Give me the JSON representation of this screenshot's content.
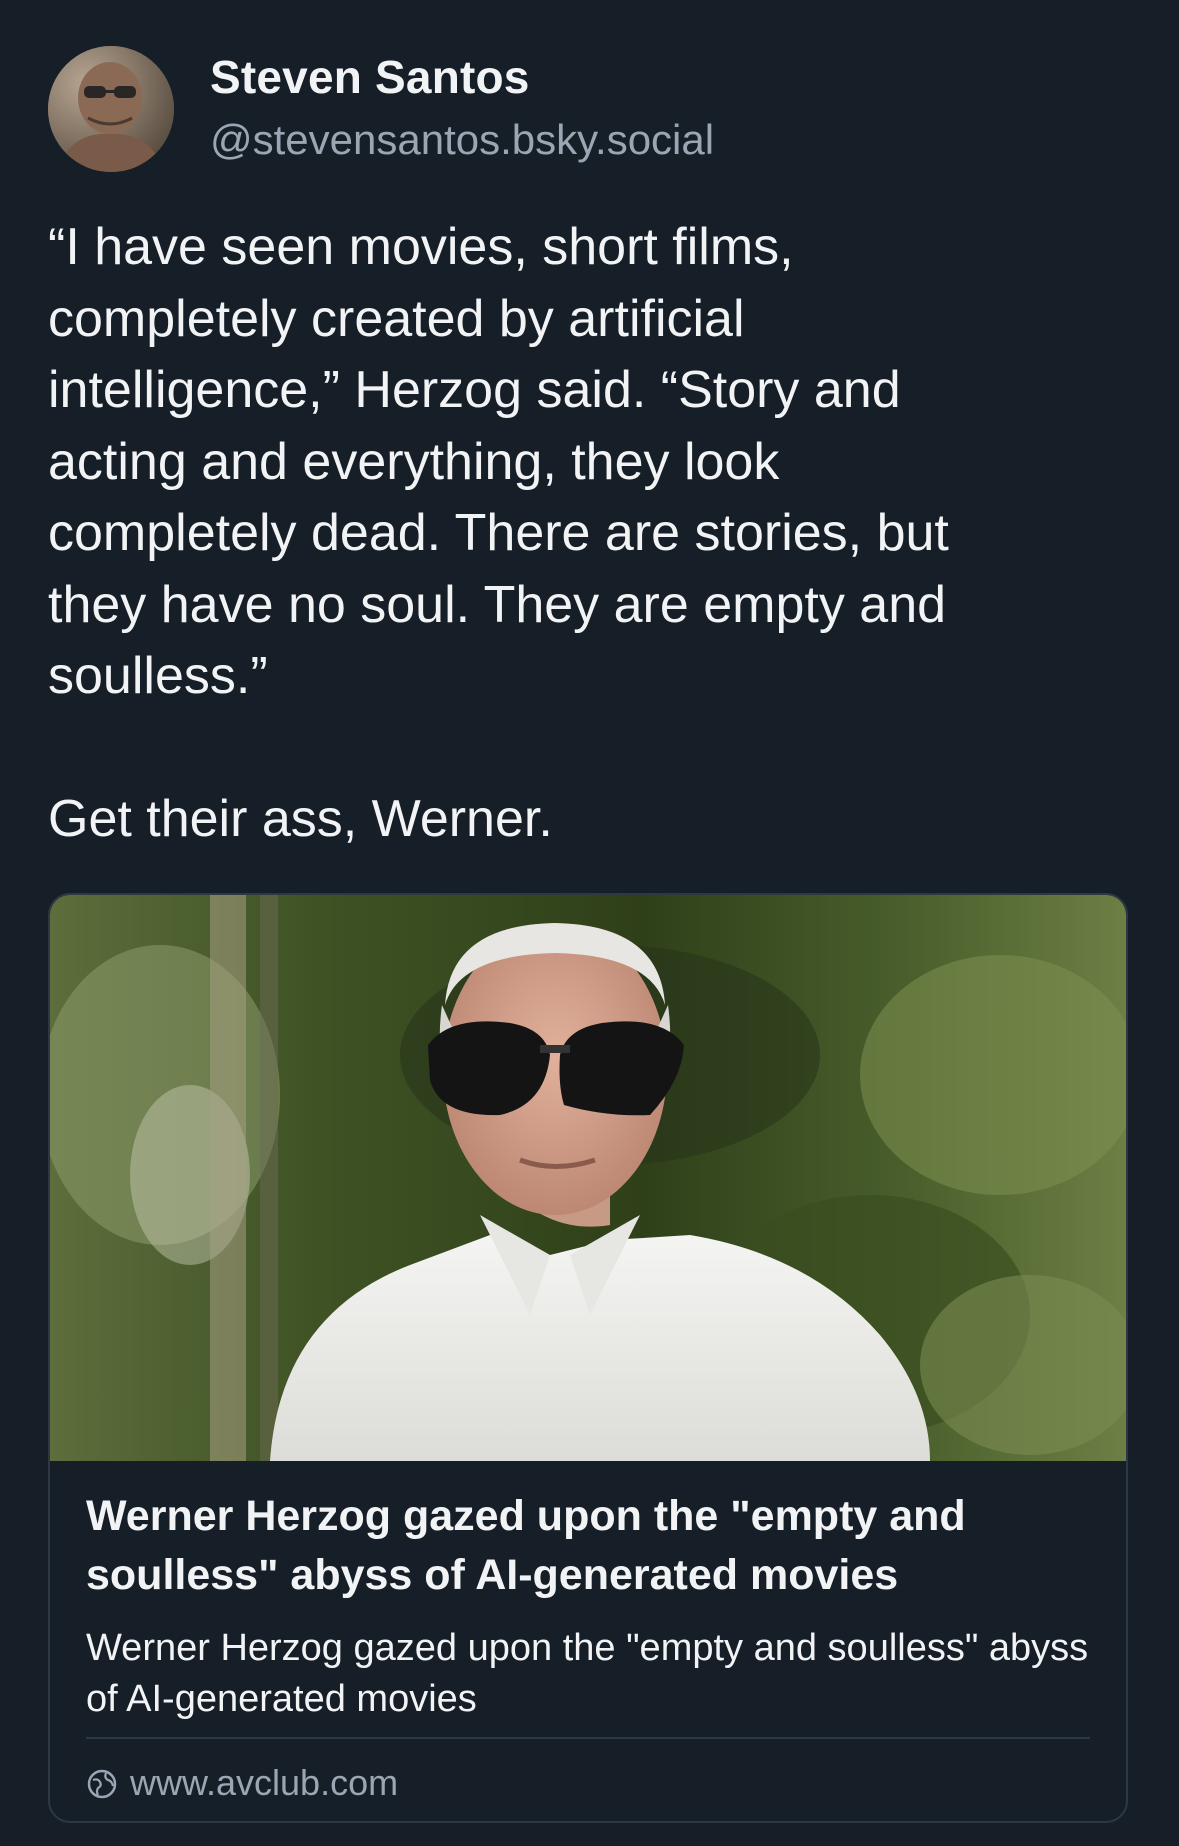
{
  "author": {
    "display_name": "Steven Santos",
    "handle": "@stevensantos.bsky.social",
    "avatar_icon": "avatar-photo"
  },
  "post": {
    "text": "“I have seen movies, short films,\ncompletely created by artificial\nintelligence,” Herzog said. “Story and\nacting and everything, they look\ncompletely dead. There are stories, but\nthey have no soul. They are empty and\nsoulless.”\n\nGet their ass, Werner."
  },
  "link_card": {
    "image_icon": "article-thumbnail-photo",
    "title": "Werner Herzog gazed upon the \"empty and soulless\" abyss of AI-generated movies",
    "description": "Werner Herzog gazed upon the \"empty and soulless\" abyss of AI-generated movies",
    "domain": "www.avclub.com",
    "domain_icon": "globe-icon"
  },
  "colors": {
    "background": "#161e27",
    "text_primary": "#f1f3f5",
    "text_secondary": "#9aa6b3",
    "border": "#2c3845"
  }
}
